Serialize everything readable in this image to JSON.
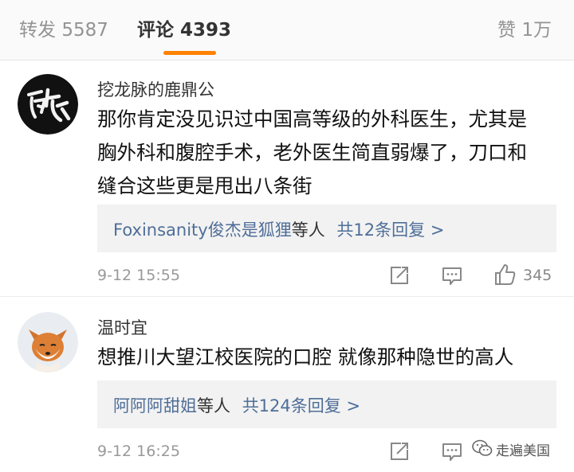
{
  "tabs": {
    "repost_label": "转发",
    "repost_count": "5587",
    "comment_label": "评论",
    "comment_count": "4393",
    "like_label": "赞",
    "like_count": "1万"
  },
  "comments": [
    {
      "username": "挖龙脉的鹿鼎公",
      "lines": [
        "那你肯定没见识过中国高等级的外科医生，尤其是",
        "胸外科和腹腔手术，老外医生简直弱爆了，刀口和",
        "缝合这些更是甩出八条街"
      ],
      "replies": {
        "user": "Foxinsanity俊杰是狐狸",
        "suffix": "等人",
        "more": "共12条回复 >"
      },
      "time": "9-12 15:55",
      "likes": "345",
      "avatar_icon": "calligraphy-avatar"
    },
    {
      "username": "温时宜",
      "lines": [
        "想推川大望江校医院的口腔  就像那种隐世的高人"
      ],
      "replies": {
        "user": "阿阿阿甜姐",
        "suffix": "等人",
        "more": "共124条回复 >"
      },
      "time": "9-12 16:25",
      "avatar_icon": "fox-avatar"
    }
  ],
  "watermark": {
    "text": "走遍美国"
  },
  "colors": {
    "accent": "#ff8200",
    "link": "#4f6e98",
    "muted": "#999999"
  }
}
